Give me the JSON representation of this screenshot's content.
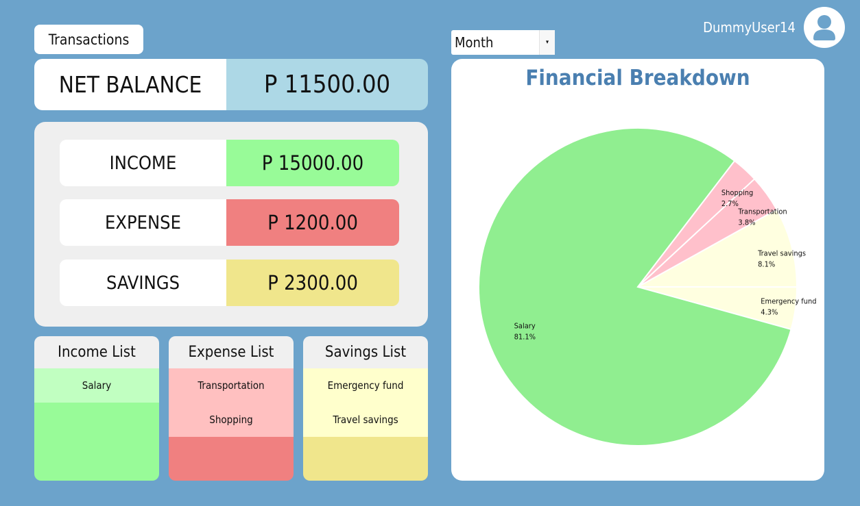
{
  "header": {
    "transactions_label": "Transactions",
    "period_select": {
      "value": "Month"
    },
    "username": "DummyUser14",
    "avatar_icon": "user-avatar-icon"
  },
  "net_balance": {
    "label": "NET BALANCE",
    "value": "P 11500.00"
  },
  "summary": [
    {
      "label": "INCOME",
      "value": "P 15000.00",
      "color": "#98fb98"
    },
    {
      "label": "EXPENSE",
      "value": "P 1200.00",
      "color": "#f08080"
    },
    {
      "label": "SAVINGS",
      "value": "P 2300.00",
      "color": "#f0e68c"
    }
  ],
  "lists": {
    "income": {
      "title": "Income List",
      "items": [
        "Salary"
      ],
      "item_color": "#c1ffc1",
      "body_color": "#98fb98"
    },
    "expense": {
      "title": "Expense List",
      "items": [
        "Transportation",
        "Shopping"
      ],
      "item_color": "#ffc0c0",
      "body_color": "#f08080"
    },
    "savings": {
      "title": "Savings List",
      "items": [
        "Emergency fund",
        "Travel savings"
      ],
      "item_color": "#ffffcc",
      "body_color": "#f0e68c"
    }
  },
  "chart_data": {
    "type": "pie",
    "title": "Financial Breakdown",
    "slices": [
      {
        "label": "Salary",
        "value": 81.1,
        "pct_label": "81.1%",
        "color": "#90ee90"
      },
      {
        "label": "Shopping",
        "value": 2.7,
        "pct_label": "2.7%",
        "color": "#ffc0cb"
      },
      {
        "label": "Transportation",
        "value": 3.8,
        "pct_label": "3.8%",
        "color": "#ffc0cb"
      },
      {
        "label": "Travel savings",
        "value": 8.1,
        "pct_label": "8.1%",
        "color": "#ffffe0"
      },
      {
        "label": "Emergency fund",
        "value": 4.3,
        "pct_label": "4.3%",
        "color": "#ffffe0"
      }
    ]
  }
}
